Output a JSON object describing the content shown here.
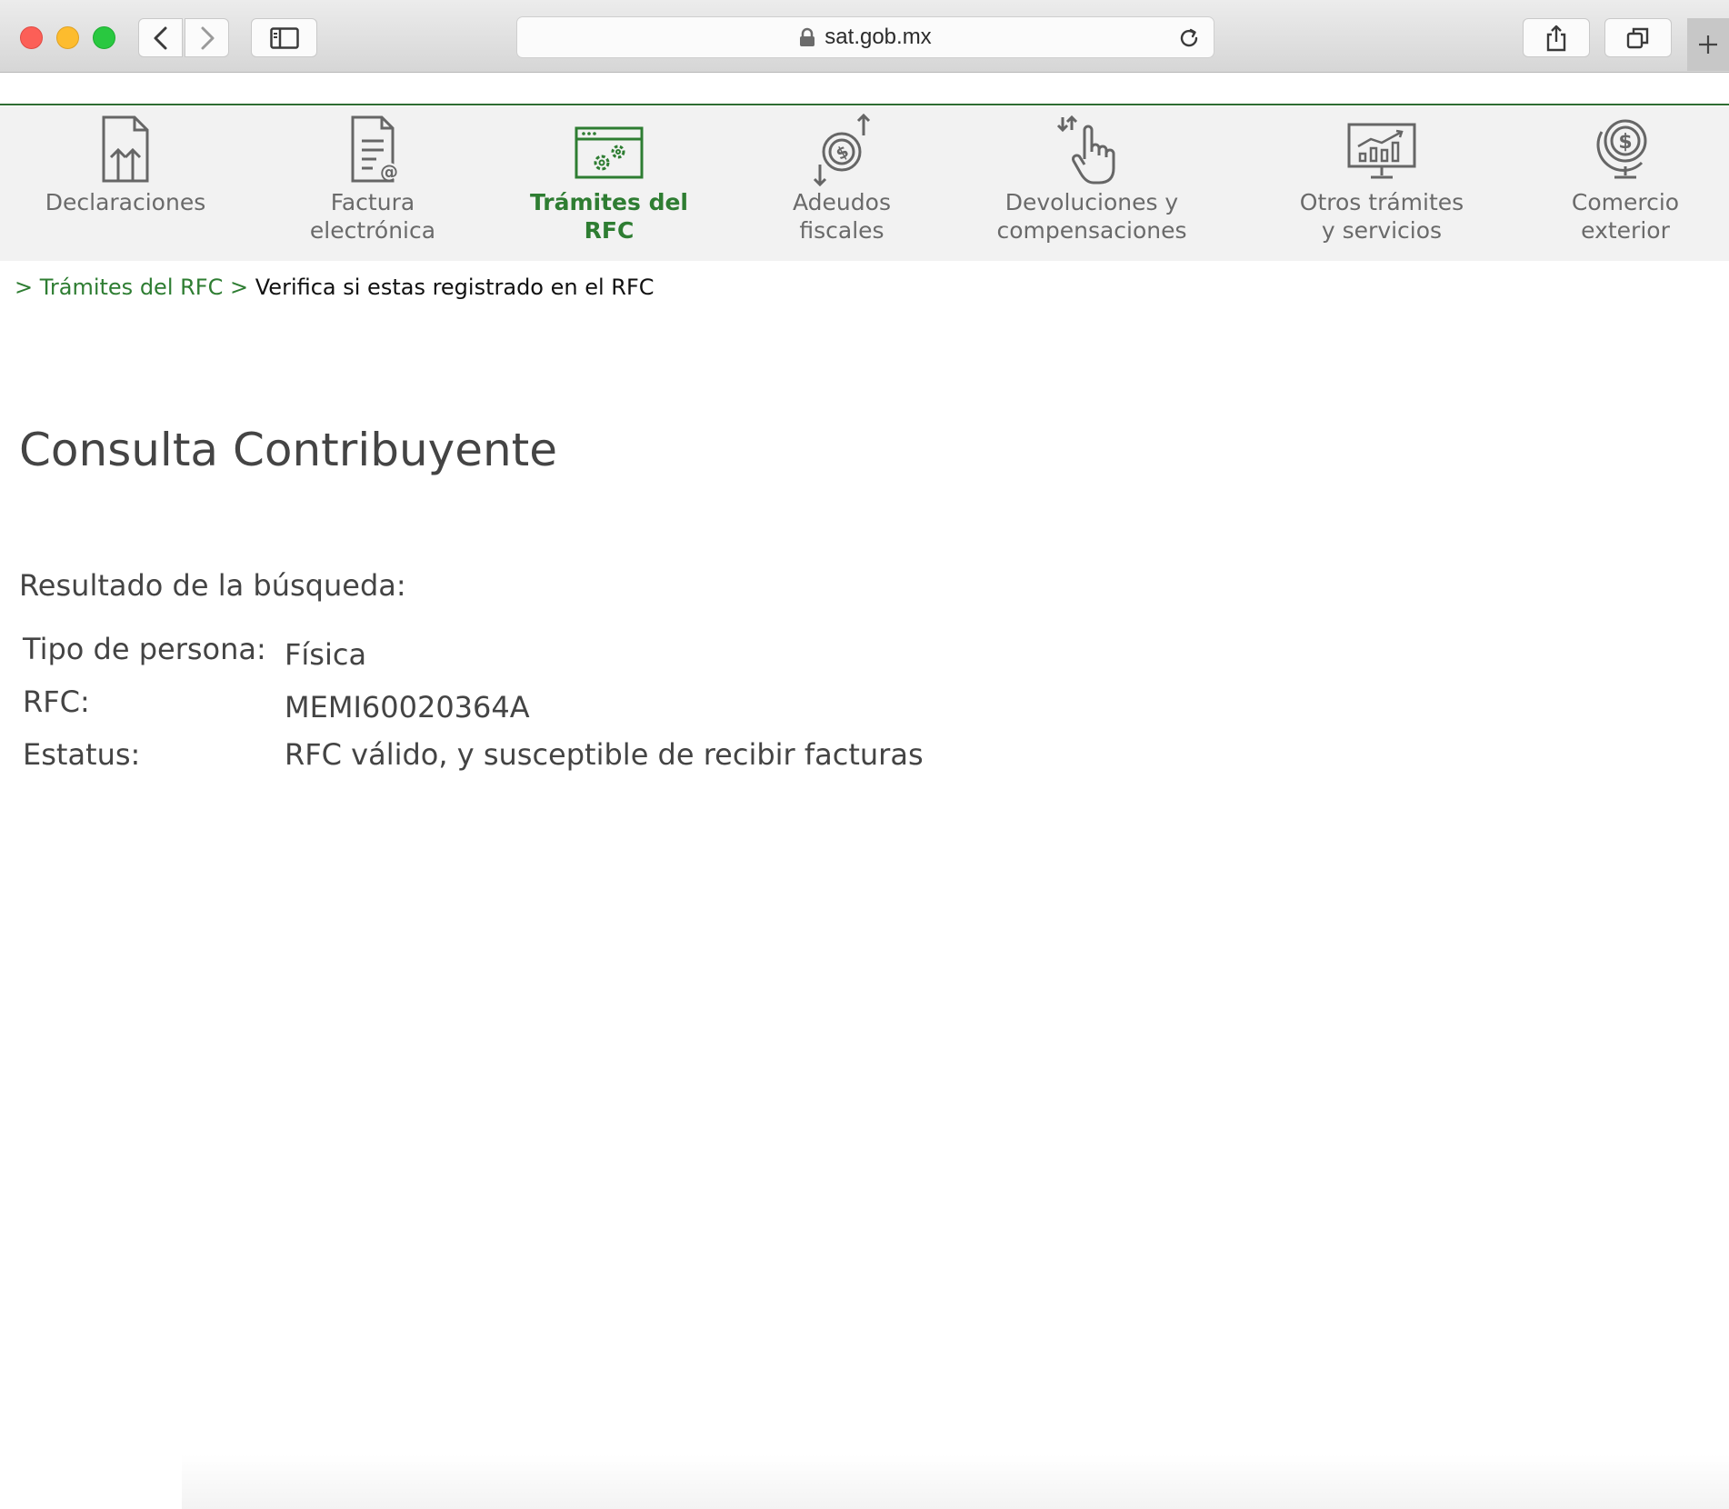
{
  "browser": {
    "url": "sat.gob.mx",
    "icons": [
      "back-icon",
      "forward-icon",
      "sidebar-icon",
      "lock-icon",
      "reload-icon",
      "share-icon",
      "tabs-icon",
      "plus-icon"
    ]
  },
  "nav": {
    "items": [
      {
        "label_line1": "Declaraciones",
        "label_line2": "",
        "icon": "declarations-document-icon"
      },
      {
        "label_line1": "Factura",
        "label_line2": "electrónica",
        "icon": "e-invoice-document-icon"
      },
      {
        "label_line1": "Trámites del",
        "label_line2": "RFC",
        "icon": "browser-gears-icon"
      },
      {
        "label_line1": "Adeudos",
        "label_line2": "fiscales",
        "icon": "coin-arrows-icon"
      },
      {
        "label_line1": "Devoluciones y",
        "label_line2": "compensaciones",
        "icon": "hand-pointer-arrows-icon"
      },
      {
        "label_line1": "Otros trámites",
        "label_line2": "y servicios",
        "icon": "monitor-chart-icon"
      },
      {
        "label_line1": "Comercio",
        "label_line2": "exterior",
        "icon": "globe-dollar-icon"
      }
    ],
    "active_index": 2,
    "active_color": "#2e7d32"
  },
  "breadcrumb": {
    "sep1": ">",
    "link": "Trámites del RFC",
    "sep2": ">",
    "current": "Verifica si estas registrado en el RFC"
  },
  "page": {
    "title": "Consulta Contribuyente",
    "result_heading": "Resultado de la búsqueda:",
    "rows": [
      {
        "label": "Tipo de persona:",
        "value": "Física"
      },
      {
        "label": "RFC:",
        "value": "MEMI60020364A"
      },
      {
        "label": "Estatus:",
        "value": "RFC válido, y susceptible de recibir facturas"
      }
    ]
  }
}
